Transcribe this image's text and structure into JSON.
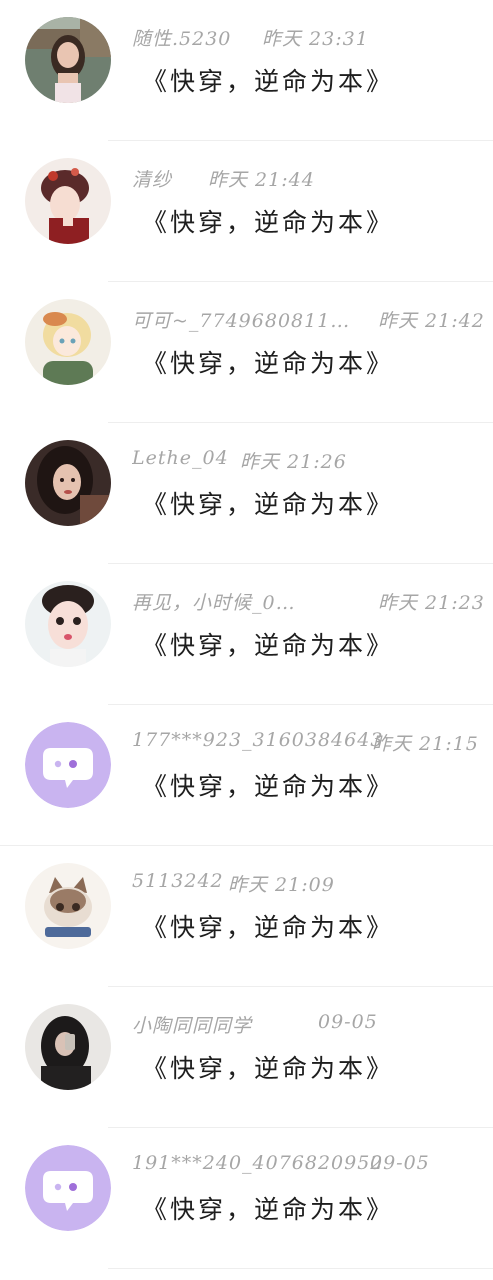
{
  "comments": [
    {
      "name": "随性.5230",
      "time": "昨天 23:31",
      "message": "《快穿，逆命为本》",
      "avatar": "photo-woman-outdoor"
    },
    {
      "name": "清纱",
      "time": "昨天 21:44",
      "message": "《快穿，逆命为本》",
      "avatar": "illustration-hanfu-girl"
    },
    {
      "name": "可可~_7749680811…",
      "time": "昨天 21:42",
      "message": "《快穿，逆命为本》",
      "avatar": "illustration-blonde-girl"
    },
    {
      "name": "Lethe_04",
      "time": "昨天 21:26",
      "message": "《快穿，逆命为本》",
      "avatar": "photo-dark-hair-girl"
    },
    {
      "name": "再见，小时候_0…",
      "time": "昨天 21:23",
      "message": "《快穿，逆命为本》",
      "avatar": "photo-pout-girl"
    },
    {
      "name": "177***923_3160384643",
      "time": "昨天 21:15",
      "message": "《快穿，逆命为本》",
      "avatar": "default-purple-chat"
    },
    {
      "name": "5113242",
      "time": "昨天 21:09",
      "message": "《快穿，逆命为本》",
      "avatar": "illustration-kitten"
    },
    {
      "name": "小陶同同同学",
      "time": "09-05",
      "message": "《快穿，逆命为本》",
      "avatar": "photo-mirror-selfie"
    },
    {
      "name": "191***240_4076820952",
      "time": "09-05",
      "message": "《快穿，逆命为本》",
      "avatar": "default-purple-chat"
    }
  ],
  "colors": {
    "meta_text": "#a6a6a6",
    "message_text": "#1e1e1e",
    "default_avatar_bg": "#c9b4f0",
    "divider": "#eeeeee"
  }
}
